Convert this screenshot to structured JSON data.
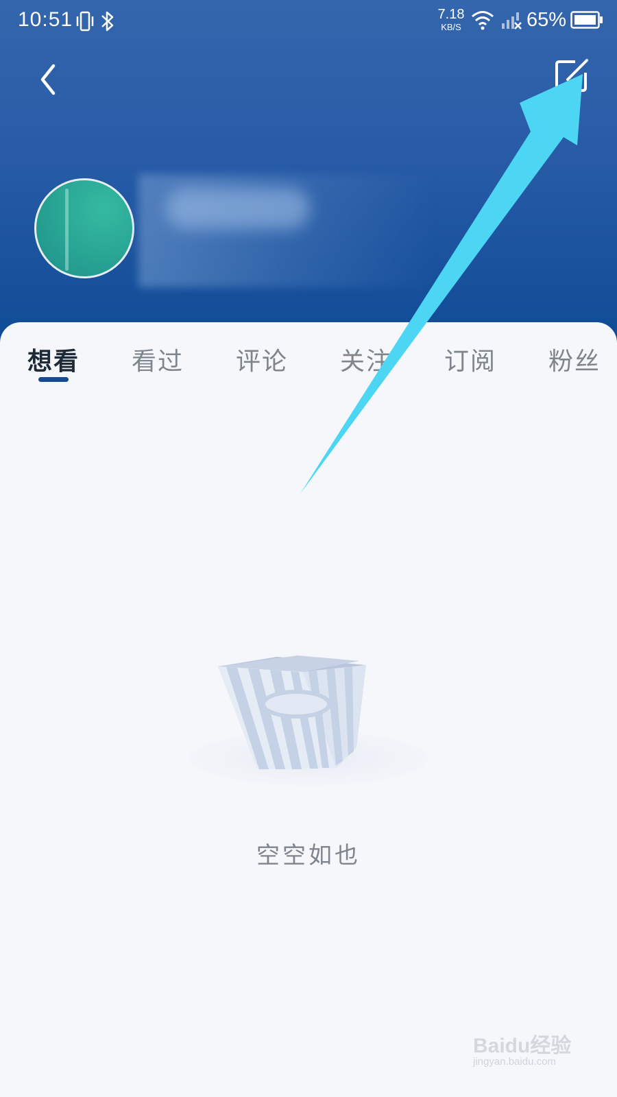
{
  "status_bar": {
    "time": "10:51",
    "net_speed_value": "7.18",
    "net_speed_unit": "KB/S",
    "battery_percent": "65%",
    "icons": [
      "vibrate-icon",
      "bluetooth-icon",
      "wifi-icon",
      "cellular-icon",
      "battery-icon"
    ]
  },
  "header": {
    "back_icon": "chevron-left-icon",
    "edit_icon": "edit-icon",
    "accent_color": "#2b5fa8"
  },
  "tabs": [
    {
      "label": "想看",
      "active": true
    },
    {
      "label": "看过",
      "active": false
    },
    {
      "label": "评论",
      "active": false
    },
    {
      "label": "关注",
      "active": false
    },
    {
      "label": "订阅",
      "active": false
    },
    {
      "label": "粉丝",
      "active": false
    }
  ],
  "empty_state": {
    "text": "空空如也",
    "icon": "popcorn-bucket-icon"
  },
  "watermark": {
    "logo_text": "Baidu经验",
    "url_text": "jingyan.baidu.com"
  },
  "colors": {
    "header_top": "#3466ad",
    "header_bottom": "#0e4a95",
    "tab_indicator": "#164b91",
    "arrow": "#4dd6f4",
    "background": "#f5f7fa"
  }
}
